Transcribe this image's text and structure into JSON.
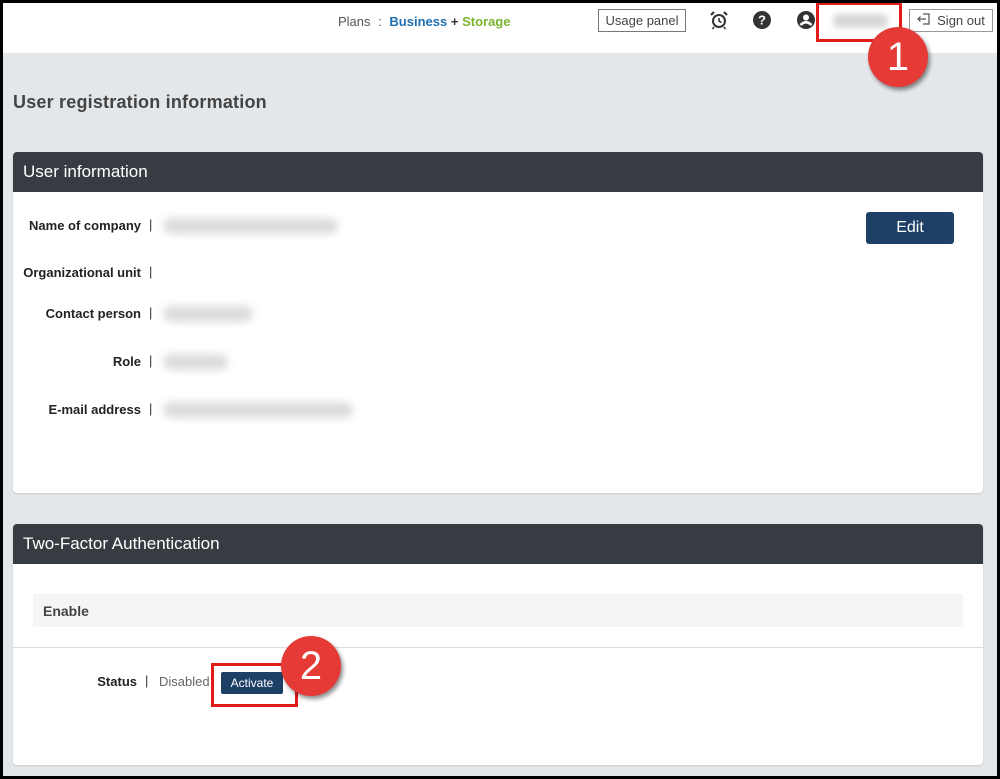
{
  "header": {
    "plans_label": "Plans",
    "plans_separator": ":",
    "plan_business": "Business",
    "plan_plus": "+",
    "plan_storage": "Storage",
    "usage_panel_label": "Usage panel",
    "sign_out_label": "Sign out",
    "icons": [
      "alarm-clock-icon",
      "help-icon",
      "user-icon",
      "sign-out-icon"
    ]
  },
  "page": {
    "title": "User registration information"
  },
  "user_info": {
    "heading": "User information",
    "edit_label": "Edit",
    "fields": [
      {
        "label": "Name of company",
        "separator": "|"
      },
      {
        "label": "Organizational unit",
        "separator": "|"
      },
      {
        "label": "Contact person",
        "separator": "|"
      },
      {
        "label": "Role",
        "separator": "|"
      },
      {
        "label": "E-mail address",
        "separator": "|"
      }
    ]
  },
  "two_factor": {
    "heading": "Two-Factor Authentication",
    "enable_label": "Enable",
    "status_label": "Status",
    "status_separator": "|",
    "status_value": "Disabled",
    "activate_label": "Activate"
  },
  "callouts": {
    "first": "1",
    "second": "2"
  },
  "colors": {
    "panel_header": "#373c43",
    "primary_button": "#1e3f66",
    "highlight": "#e21b1b",
    "callout": "#e53a35",
    "business": "#1f6fb3",
    "storage": "#7ab32e"
  }
}
